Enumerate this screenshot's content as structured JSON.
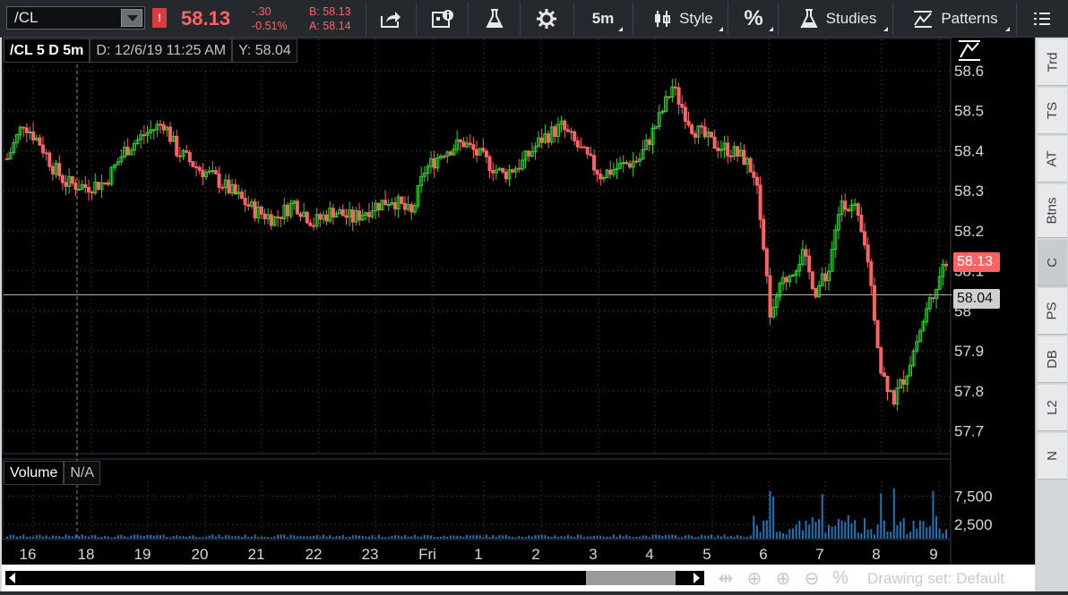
{
  "toolbar": {
    "symbol": "/CL",
    "alert_flag": "!",
    "last_price": "58.13",
    "net_change": "-.30",
    "pct_change": "-0.51%",
    "bid": "B: 58.13",
    "ask": "A: 58.14",
    "interval_label": "5m",
    "style_label": "Style",
    "percent_label": "%",
    "studies_label": "Studies",
    "patterns_label": "Patterns"
  },
  "chart_header": {
    "title": "/CL 5 D 5m",
    "date_readout": "D: 12/6/19 11:25 AM",
    "y_readout": "Y: 58.04"
  },
  "volume_header": {
    "title": "Volume",
    "value": "N/A"
  },
  "price_badges": {
    "last": "58.13",
    "cursor": "58.04"
  },
  "side_tabs": [
    "Trd",
    "TS",
    "AT",
    "Btns",
    "C",
    "PS",
    "DB",
    "L2",
    "N"
  ],
  "side_active": "C",
  "bottom_bar": {
    "drawing_set": "Drawing set: Default"
  },
  "colors": {
    "up_candle": "#2fd22f",
    "down_candle": "#ff6262",
    "volume_bar": "#1f73b7",
    "last_price_badge": "#ff6464",
    "grid": "#4a4a4a"
  },
  "chart_data": {
    "type": "candlestick",
    "price_axis": {
      "min": 57.65,
      "max": 58.62,
      "ticks": [
        "58.6",
        "58.5",
        "58.4",
        "58.3",
        "58.2",
        "58.1",
        "58",
        "57.9",
        "57.8",
        "57.7"
      ],
      "tick_values": [
        58.6,
        58.5,
        58.4,
        58.3,
        58.2,
        58.1,
        58.0,
        57.9,
        57.8,
        57.7
      ]
    },
    "volume_axis": {
      "min": 0,
      "max": 9500,
      "ticks": [
        "7,500",
        "2,500"
      ],
      "tick_values": [
        7500,
        2500
      ]
    },
    "x_ticks": [
      "16",
      "18",
      "19",
      "20",
      "21",
      "22",
      "23",
      "Fri",
      "1",
      "2",
      "3",
      "4",
      "5",
      "6",
      "7",
      "8",
      "9"
    ],
    "crosshair_price": 58.04,
    "close_path": [
      [
        0,
        58.38
      ],
      [
        5,
        58.47
      ],
      [
        10,
        58.42
      ],
      [
        14,
        58.36
      ],
      [
        18,
        58.32
      ],
      [
        24,
        58.31
      ],
      [
        30,
        58.32
      ],
      [
        36,
        58.4
      ],
      [
        42,
        58.44
      ],
      [
        48,
        58.47
      ],
      [
        52,
        58.4
      ],
      [
        58,
        58.36
      ],
      [
        64,
        58.33
      ],
      [
        70,
        58.29
      ],
      [
        76,
        58.25
      ],
      [
        82,
        58.23
      ],
      [
        88,
        58.27
      ],
      [
        94,
        58.22
      ],
      [
        100,
        58.25
      ],
      [
        106,
        58.23
      ],
      [
        112,
        58.26
      ],
      [
        118,
        58.28
      ],
      [
        124,
        58.24
      ],
      [
        128,
        58.35
      ],
      [
        134,
        58.4
      ],
      [
        140,
        58.42
      ],
      [
        146,
        58.38
      ],
      [
        152,
        58.34
      ],
      [
        158,
        58.37
      ],
      [
        164,
        58.43
      ],
      [
        170,
        58.46
      ],
      [
        176,
        58.4
      ],
      [
        182,
        58.34
      ],
      [
        188,
        58.36
      ],
      [
        194,
        58.38
      ],
      [
        200,
        58.48
      ],
      [
        204,
        58.56
      ],
      [
        210,
        58.46
      ],
      [
        216,
        58.42
      ],
      [
        222,
        58.4
      ],
      [
        226,
        58.38
      ],
      [
        230,
        58.33
      ],
      [
        234,
        58.0
      ],
      [
        238,
        58.07
      ],
      [
        244,
        58.14
      ],
      [
        248,
        58.05
      ],
      [
        252,
        58.1
      ],
      [
        256,
        58.28
      ],
      [
        260,
        58.25
      ],
      [
        264,
        58.13
      ],
      [
        268,
        57.85
      ],
      [
        272,
        57.78
      ],
      [
        276,
        57.85
      ],
      [
        280,
        57.95
      ],
      [
        284,
        58.05
      ],
      [
        288,
        58.13
      ]
    ]
  }
}
